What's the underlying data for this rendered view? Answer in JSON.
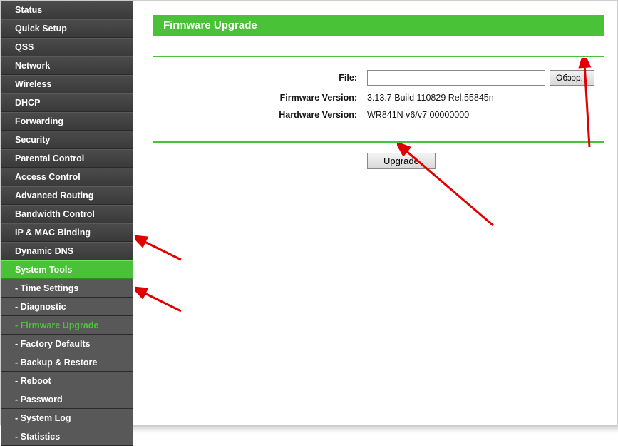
{
  "sidebar": {
    "items": [
      {
        "label": "Status"
      },
      {
        "label": "Quick Setup"
      },
      {
        "label": "QSS"
      },
      {
        "label": "Network"
      },
      {
        "label": "Wireless"
      },
      {
        "label": "DHCP"
      },
      {
        "label": "Forwarding"
      },
      {
        "label": "Security"
      },
      {
        "label": "Parental Control"
      },
      {
        "label": "Access Control"
      },
      {
        "label": "Advanced Routing"
      },
      {
        "label": "Bandwidth Control"
      },
      {
        "label": "IP & MAC Binding"
      },
      {
        "label": "Dynamic DNS"
      },
      {
        "label": "System Tools"
      },
      {
        "label": "- Time Settings"
      },
      {
        "label": "- Diagnostic"
      },
      {
        "label": "- Firmware Upgrade"
      },
      {
        "label": "- Factory Defaults"
      },
      {
        "label": "- Backup & Restore"
      },
      {
        "label": "- Reboot"
      },
      {
        "label": "- Password"
      },
      {
        "label": "- System Log"
      },
      {
        "label": "- Statistics"
      }
    ]
  },
  "page": {
    "title": "Firmware Upgrade",
    "file_label": "File:",
    "file_value": "",
    "browse_label": "Обзор...",
    "fw_label": "Firmware Version:",
    "fw_value": "3.13.7 Build 110829 Rel.55845n",
    "hw_label": "Hardware Version:",
    "hw_value": "WR841N v6/v7 00000000",
    "upgrade_label": "Upgrade"
  }
}
